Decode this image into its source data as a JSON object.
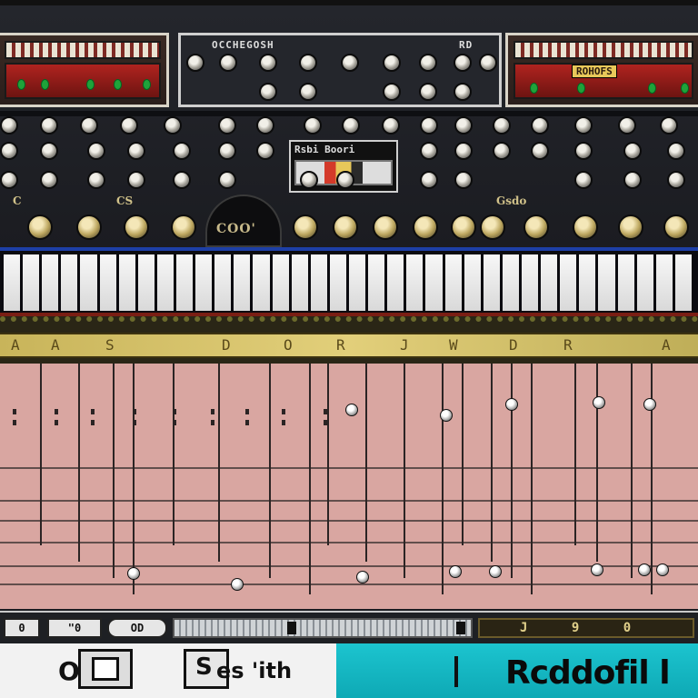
{
  "rack": {
    "mid_title": "OCCHEGOSH",
    "mid_title_right": "RD",
    "left_label": "",
    "right_label": "ROHOFS",
    "display_title": "Rsbi Boori",
    "arch_label": "COO'",
    "panel_text_left": "CS",
    "panel_text_right": "Gsdo",
    "panel_text_small": "C"
  },
  "ruler": {
    "marks": [
      "A",
      "A",
      "S",
      "D",
      "O",
      "R",
      "J",
      "W",
      "D",
      "R",
      "A"
    ]
  },
  "transport": {
    "btn_1": "0",
    "btn_2": "\"0",
    "btn_3": "OD",
    "time_display": "J 9 0"
  },
  "bottom": {
    "left_text": "O",
    "icon_mid_label": "S",
    "mid_text": "es 'ith",
    "right_text": "Rcddofil l",
    "colors": {
      "cyan": "#1cc4cf",
      "light": "#f2f2f2"
    }
  }
}
